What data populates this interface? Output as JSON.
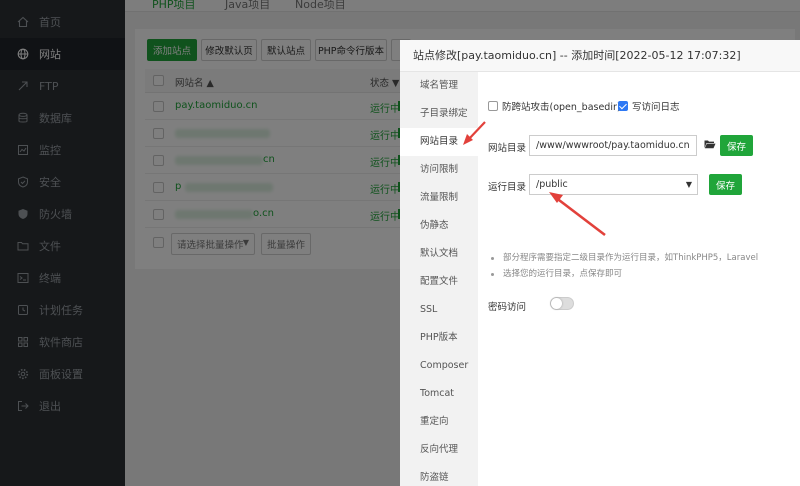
{
  "colors": {
    "accent": "#20a53a",
    "sidebar_bg": "#2c3035",
    "arrow": "#e2413b",
    "checkbox_on": "#2d78f4"
  },
  "sidebar": {
    "items": [
      {
        "label": "首页",
        "icon": "home-icon"
      },
      {
        "label": "网站",
        "icon": "globe-icon",
        "active": true
      },
      {
        "label": "FTP",
        "icon": "ftp-icon"
      },
      {
        "label": "数据库",
        "icon": "database-icon"
      },
      {
        "label": "监控",
        "icon": "monitor-icon"
      },
      {
        "label": "安全",
        "icon": "shield-check-icon"
      },
      {
        "label": "防火墙",
        "icon": "firewall-shield-icon"
      },
      {
        "label": "文件",
        "icon": "folder-icon"
      },
      {
        "label": "终端",
        "icon": "terminal-icon"
      },
      {
        "label": "计划任务",
        "icon": "clock-icon"
      },
      {
        "label": "软件商店",
        "icon": "grid-icon"
      },
      {
        "label": "面板设置",
        "icon": "gear-icon"
      },
      {
        "label": "退出",
        "icon": "logout-icon"
      }
    ]
  },
  "main": {
    "tabs": [
      "PHP项目",
      "Java项目",
      "Node项目"
    ],
    "toolbar": {
      "add_site": "添加站点",
      "edit_default_page": "修改默认页",
      "default_site": "默认站点",
      "php_cli_version": "PHP命令行版本"
    },
    "table": {
      "headers": {
        "name": "网站名 ▲",
        "status": "状态 ▼"
      },
      "rows": [
        {
          "name": "pay.taomiduo.cn",
          "status": "运行中"
        },
        {
          "name": "",
          "status": "运行中"
        },
        {
          "name": "cn",
          "status": "运行中"
        },
        {
          "name": "p",
          "status": "运行中"
        },
        {
          "name": "o.cn",
          "status": "运行中"
        }
      ]
    },
    "batch": {
      "select_placeholder": "请选择批量操作",
      "batch_button": "批量操作"
    }
  },
  "modal": {
    "title": "站点修改[pay.taomiduo.cn] -- 添加时间[2022-05-12 17:07:32]",
    "menu": [
      "域名管理",
      "子目录绑定",
      "网站目录",
      "访问限制",
      "流量限制",
      "伪静态",
      "默认文档",
      "配置文件",
      "SSL",
      "PHP版本",
      "Composer",
      "Tomcat",
      "重定向",
      "反向代理",
      "防盗链"
    ],
    "active_menu_index": 2,
    "anti_xss_label": "防跨站攻击(open_basedir)",
    "anti_xss_checked": false,
    "write_log_label": "写访问日志",
    "write_log_checked": true,
    "site_dir_label": "网站目录",
    "site_dir_value": "/www/wwwroot/pay.taomiduo.cn",
    "run_dir_label": "运行目录",
    "run_dir_value": "/public",
    "save_label": "保存",
    "tips": [
      "部分程序需要指定二级目录作为运行目录，如ThinkPHP5，Laravel",
      "选择您的运行目录，点保存即可"
    ],
    "password_access_label": "密码访问",
    "password_access_enabled": false
  }
}
